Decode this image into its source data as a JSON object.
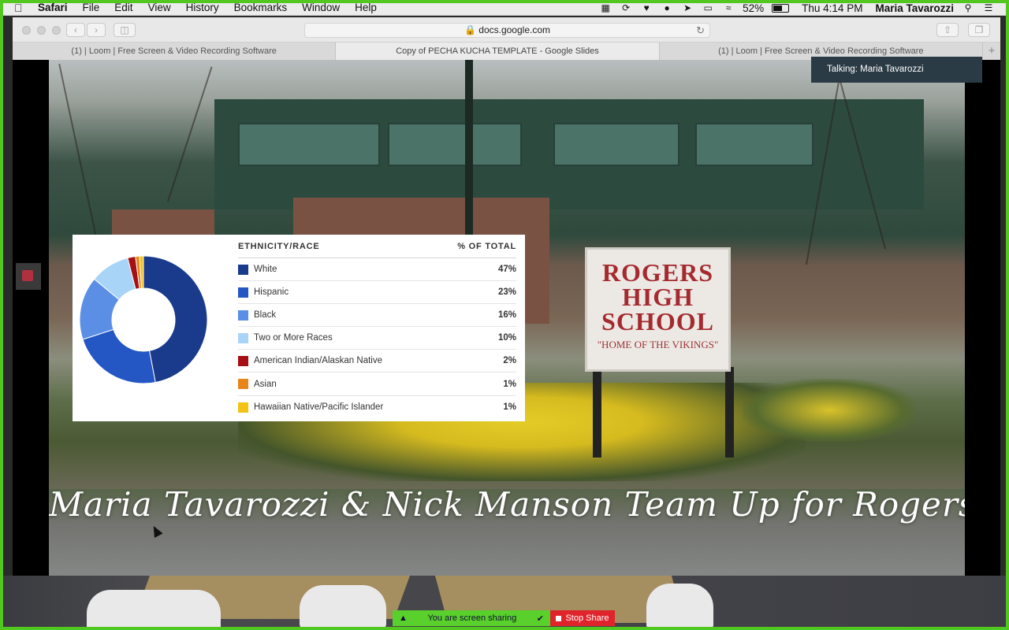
{
  "menubar": {
    "apple_icon": "apple-icon",
    "app_name": "Safari",
    "items": [
      "File",
      "Edit",
      "View",
      "History",
      "Bookmarks",
      "Window",
      "Help"
    ],
    "battery_percent": "52%",
    "clock": "Thu 4:14 PM",
    "user": "Maria Tavarozzi"
  },
  "browser": {
    "url": "docs.google.com",
    "tabs": [
      "(1) | Loom | Free Screen & Video Recording Software",
      "Copy of PECHA KUCHA TEMPLATE - Google Slides",
      "(1) | Loom | Free Screen & Video Recording Software"
    ],
    "active_tab": 1
  },
  "zoom": {
    "talking": "Talking: Maria Tavarozzi",
    "share_status": "You are screen sharing",
    "stop_share": "Stop Share",
    "status_color": "#59d02c",
    "stop_color": "#e0242b"
  },
  "slide": {
    "sign": {
      "line1": "ROGERS",
      "line2": "HIGH",
      "line3": "SCHOOL",
      "subtitle": "\"HOME OF THE VIKINGS\""
    },
    "caption": "Maria Tavarozzi & Nick Manson Team Up for Rogers"
  },
  "chart_data": {
    "type": "pie",
    "donut": true,
    "header_label": "ETHNICITY/RACE",
    "header_value": "% OF TOTAL",
    "categories": [
      "White",
      "Hispanic",
      "Black",
      "Two or More Races",
      "American Indian/Alaskan Native",
      "Asian",
      "Hawaiian Native/Pacific Islander"
    ],
    "values": [
      47,
      23,
      16,
      10,
      2,
      1,
      1
    ],
    "labels": [
      "47%",
      "23%",
      "16%",
      "10%",
      "2%",
      "1%",
      "1%"
    ],
    "colors": [
      "#1a3a8c",
      "#2456c4",
      "#5b8fe6",
      "#a8d4f7",
      "#a50f15",
      "#e8851a",
      "#f2c315"
    ]
  }
}
